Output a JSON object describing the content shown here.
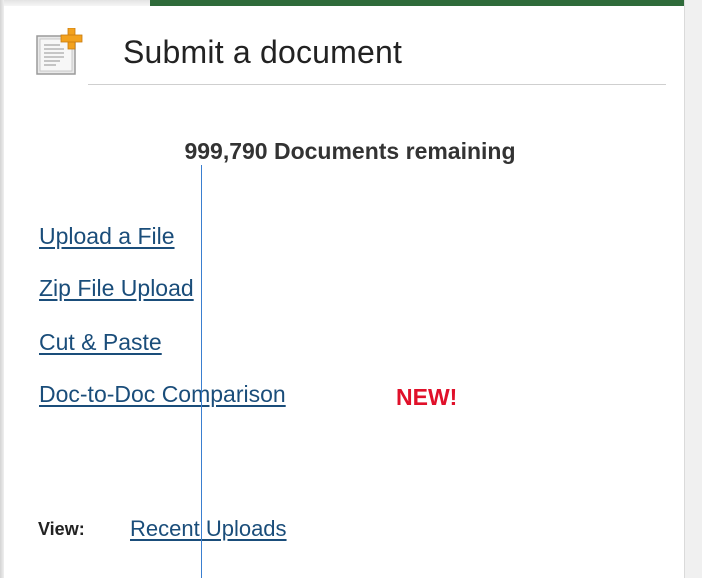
{
  "panel": {
    "title": "Submit a document",
    "icon": "document-add-icon",
    "remaining": "999,790 Documents remaining"
  },
  "links": {
    "upload_file": "Upload a File",
    "zip_upload": "Zip File Upload",
    "cut_paste": "Cut & Paste",
    "doc_comparison": "Doc-to-Doc Comparison",
    "new_badge": "NEW!"
  },
  "view": {
    "label": "View:",
    "recent_uploads": "Recent Uploads"
  },
  "colors": {
    "link": "#1a4d7a",
    "new_badge": "#e0102a",
    "accent_bar": "#2f6b3a"
  }
}
